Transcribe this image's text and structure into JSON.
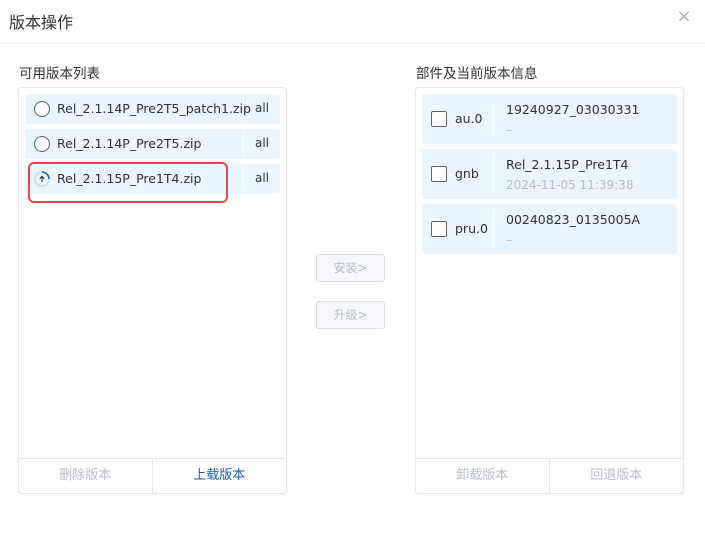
{
  "dialog": {
    "title": "版本操作",
    "close_glyph": "×"
  },
  "left": {
    "title": "可用版本列表",
    "packages": [
      {
        "name": "Rel_2.1.14P_Pre2T5_patch1.zip",
        "tag": "all",
        "state": "radio"
      },
      {
        "name": "Rel_2.1.14P_Pre2T5.zip",
        "tag": "all",
        "state": "radio"
      },
      {
        "name": "Rel_2.1.15P_Pre1T4.zip",
        "tag": "all",
        "state": "uploading"
      }
    ],
    "delete_label": "删除版本",
    "upload_label": "上载版本"
  },
  "middle": {
    "install_label": "安装>",
    "upgrade_label": "升级>"
  },
  "right": {
    "title": "部件及当前版本信息",
    "components": [
      {
        "name": "au.0",
        "version": "19240927_03030331",
        "time": "–"
      },
      {
        "name": "gnb",
        "version": "Rel_2.1.15P_Pre1T4",
        "time": "2024-11-05 11:39:38"
      },
      {
        "name": "pru.0",
        "version": "00240823_0135005A",
        "time": "–"
      }
    ],
    "uninstall_label": "卸载版本",
    "rollback_label": "回退版本"
  },
  "colors": {
    "item_bg": "#eaf5fd",
    "accent": "#1f5fa8",
    "highlight": "#e5484d",
    "disabled": "#b8bcc4"
  }
}
